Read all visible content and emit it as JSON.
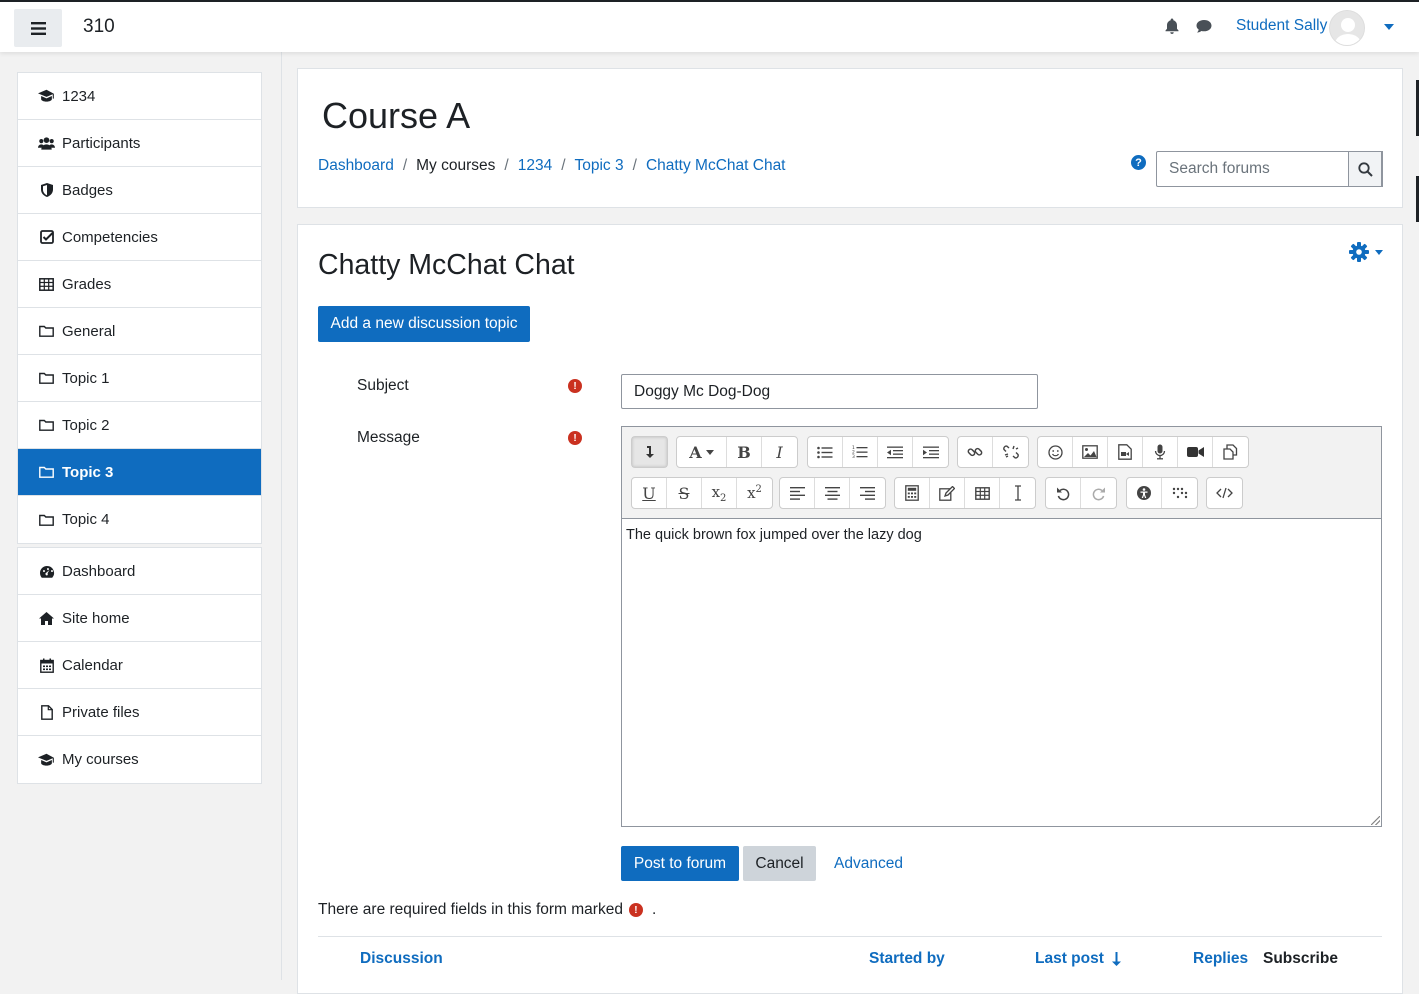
{
  "navbar": {
    "site_name": "310",
    "user_name": "Student Sally"
  },
  "drawer": {
    "course_items": [
      {
        "label": "1234",
        "icon": "graduation-cap-icon"
      },
      {
        "label": "Participants",
        "icon": "users-icon"
      },
      {
        "label": "Badges",
        "icon": "shield-icon"
      },
      {
        "label": "Competencies",
        "icon": "check-square-icon"
      },
      {
        "label": "Grades",
        "icon": "table-icon"
      },
      {
        "label": "General",
        "icon": "folder-icon"
      },
      {
        "label": "Topic 1",
        "icon": "folder-icon"
      },
      {
        "label": "Topic 2",
        "icon": "folder-icon"
      },
      {
        "label": "Topic 3",
        "icon": "folder-icon",
        "active": true
      },
      {
        "label": "Topic 4",
        "icon": "folder-icon"
      }
    ],
    "site_items": [
      {
        "label": "Dashboard",
        "icon": "tachometer-icon"
      },
      {
        "label": "Site home",
        "icon": "home-icon"
      },
      {
        "label": "Calendar",
        "icon": "calendar-icon"
      },
      {
        "label": "Private files",
        "icon": "file-icon"
      },
      {
        "label": "My courses",
        "icon": "graduation-cap-icon"
      }
    ]
  },
  "header": {
    "course_title": "Course A",
    "breadcrumb": [
      "Dashboard",
      "My courses",
      "1234",
      "Topic 3",
      "Chatty McChat Chat"
    ],
    "help_symbol": "?",
    "search_placeholder": "Search forums"
  },
  "forum": {
    "title": "Chatty McChat Chat",
    "add_topic_label": "Add a new discussion topic",
    "subject_label": "Subject",
    "subject_value": "Doggy Mc Dog-Dog",
    "message_label": "Message",
    "message_value": "The quick brown fox jumped over the lazy dog",
    "required_symbol": "!",
    "post_label": "Post to forum",
    "cancel_label": "Cancel",
    "advanced_label": "Advanced",
    "required_note": "There are required fields in this form marked",
    "required_note_end": ".",
    "columns": {
      "discussion": "Discussion",
      "started_by": "Started by",
      "last_post": "Last post",
      "replies": "Replies",
      "subscribe": "Subscribe"
    }
  },
  "colors": {
    "brand": "#0f6cbf",
    "required": "#ca3120",
    "text": "#1d2125"
  }
}
